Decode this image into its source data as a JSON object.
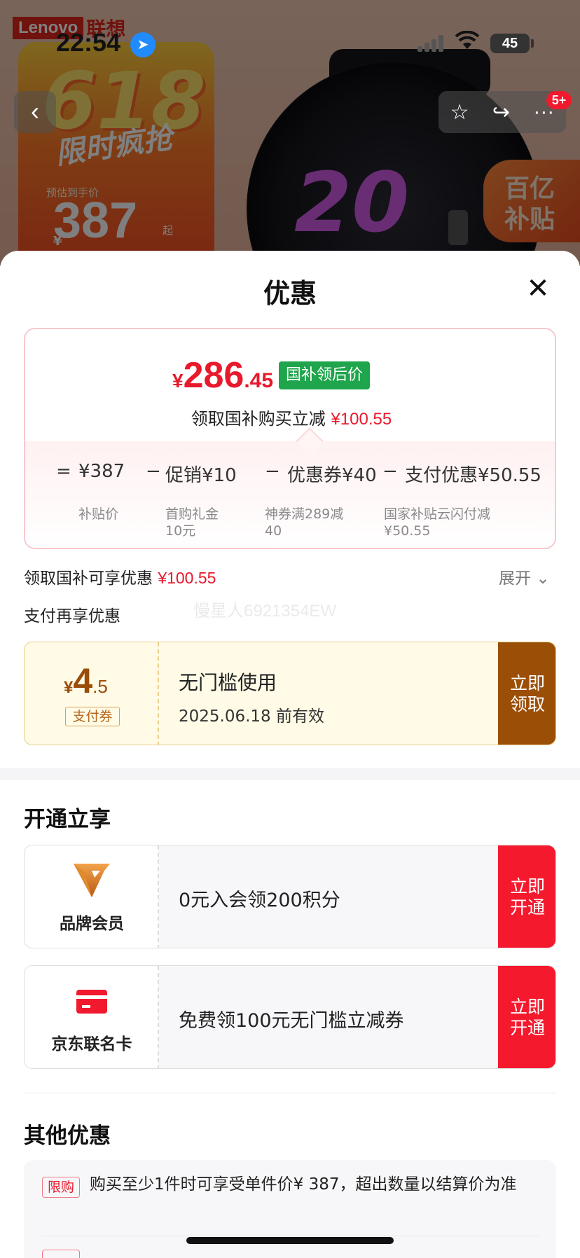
{
  "status_bar": {
    "time": "22:54",
    "battery": "45"
  },
  "background": {
    "brand_logo_en": "Lenovo",
    "brand_logo_cn": "联想",
    "promo_event": "618",
    "promo_flash": "限时疯抢",
    "promo_estimate_label": "预估到手价",
    "promo_price": "387",
    "promo_currency": "¥",
    "promo_suffix": "起",
    "watch_display": "20",
    "subsidy_badge_line1": "百亿",
    "subsidy_badge_line2": "补贴"
  },
  "nav": {
    "back_icon": "chevron-left-icon",
    "favorite_icon": "star-icon",
    "share_icon": "share-icon",
    "more_icon": "more-icon",
    "badge": "5+"
  },
  "sheet": {
    "title": "优惠",
    "close_icon": "close-icon"
  },
  "summary": {
    "final_currency": "¥",
    "final_int": "286",
    "final_dec": ".45",
    "final_tag": "国补领后价",
    "subtitle_prefix": "领取国补购买立减",
    "subtitle_amount": "¥100.55",
    "equals": "=",
    "base_price": "¥387",
    "base_price_label": "补贴价",
    "minus": "−",
    "promo_discount": "促销¥10",
    "promo_discount_label_1": "首购礼金",
    "promo_discount_label_2": "10元",
    "coupon_discount": "优惠券¥40",
    "coupon_discount_label_1": "神券满289减",
    "coupon_discount_label_2": "40",
    "payment_discount": "支付优惠¥50.55",
    "payment_discount_label_1": "国家补贴云闪付减",
    "payment_discount_label_2": "¥50.55"
  },
  "claim": {
    "label": "领取国补可享优惠",
    "amount": "¥100.55",
    "expand_label": "展开",
    "pay_more_label": "支付再享优惠",
    "watermark": "慢星人6921354EW"
  },
  "coupon": {
    "currency": "¥",
    "amount_int": "4",
    "amount_dec": ".5",
    "tag": "支付券",
    "title": "无门槛使用",
    "valid_until": "2025.06.18 前有效",
    "button": "立即领取"
  },
  "open_section": {
    "title": "开通立享",
    "items": [
      {
        "icon": "brand-member-v-icon",
        "name": "品牌会员",
        "desc": "0元入会领200积分",
        "button": "立即开通"
      },
      {
        "icon": "credit-card-icon",
        "name": "京东联名卡",
        "desc": "免费领100元无门槛立减券",
        "button": "立即开通"
      }
    ]
  },
  "other_section": {
    "title": "其他优惠",
    "items": [
      {
        "tag": "限购",
        "text": "购买至少1件时可享受单件价¥ 387，超出数量以结算价为准"
      }
    ]
  },
  "colors": {
    "price_red": "#e8192c",
    "tag_green": "#1fa54b",
    "coupon_brown": "#9b4e05",
    "open_red": "#f5192e"
  }
}
